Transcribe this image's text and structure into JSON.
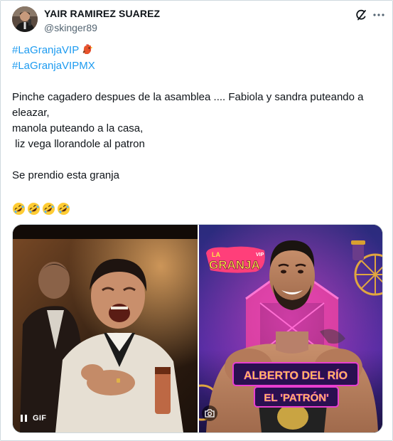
{
  "author": {
    "display_name": "YAIR RAMIREZ SUAREZ",
    "handle": "@skinger89",
    "avatar_icon": "avatar"
  },
  "header_actions": {
    "grok_icon": "grok-icon",
    "more_icon": "more-options-icon"
  },
  "tweet": {
    "hashtag_1": "#LaGranjaVIP",
    "hashtag_1_emoji": "rooster-emoji",
    "hashtag_2": "#LaGranjaVIPMX",
    "line_1": "Pinche cagadero despues de la asamblea .... Fabiola y sandra puteando a",
    "line_2": "eleazar,",
    "line_3": "manola puteando a la casa,",
    "line_4": " liz vega llorandole al patron",
    "line_5": "Se prendio esta granja",
    "emojis": [
      "rolling-on-floor-laughing",
      "rolling-on-floor-laughing",
      "rolling-on-floor-laughing",
      "rolling-on-floor-laughing"
    ]
  },
  "media": {
    "left": {
      "kind": "gif",
      "gif_label": "GIF",
      "pause_icon": "pause-icon"
    },
    "right": {
      "kind": "image",
      "logo_text": "LA GRANJA",
      "logo_sub": "VIP",
      "name_line_1": "ALBERTO DEL RÍO",
      "name_line_2": "EL 'PATRÓN'",
      "camera_icon": "camera-icon"
    }
  },
  "colors": {
    "hashtag": "#1d9bf0",
    "text": "#0f1419",
    "secondary": "#536471",
    "border": "#cfd9de",
    "banner_text": "#ffd23f",
    "banner_glow": "#e83fd0"
  }
}
